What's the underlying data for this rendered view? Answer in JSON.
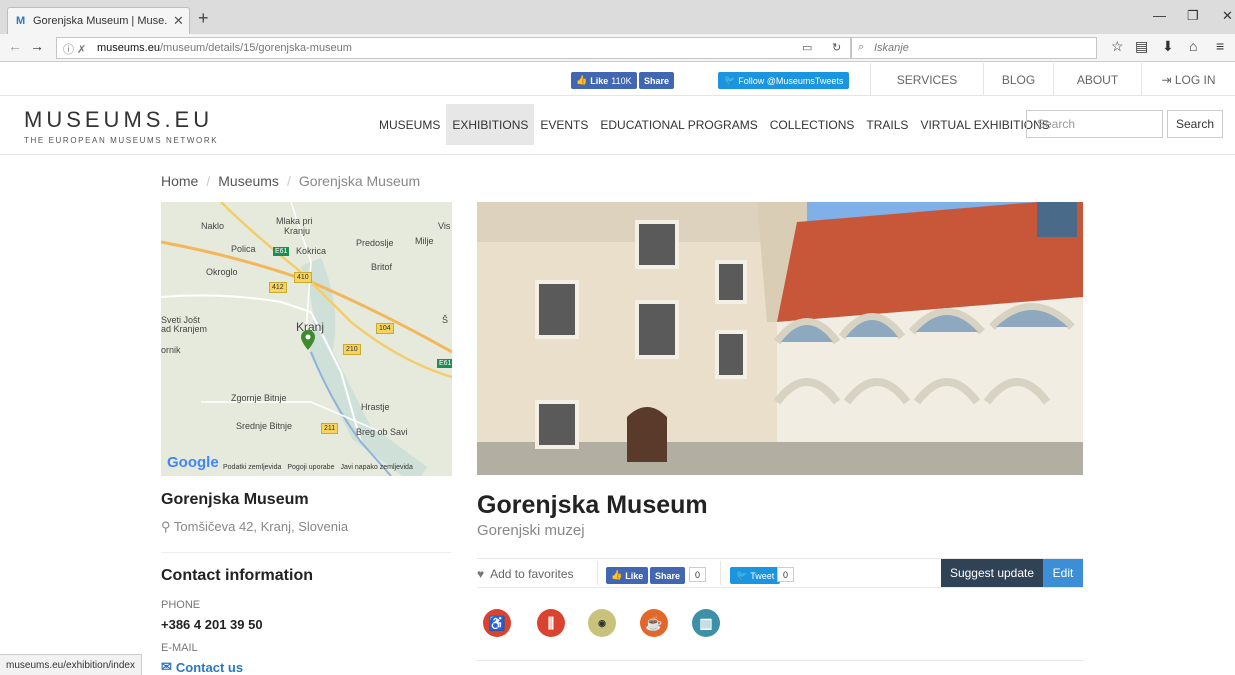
{
  "browser": {
    "tab_title": "Gorenjska Museum | Muse...",
    "url_host": "museums.eu",
    "url_path": "/museum/details/15/gorenjska-museum",
    "search_placeholder": "Iskanje",
    "status_url": "museums.eu/exhibition/index"
  },
  "topstrip": {
    "fb_like": "Like",
    "fb_count": "110K",
    "fb_share": "Share",
    "twitter_follow": "Follow @MuseumsTweets",
    "links": [
      "SERVICES",
      "BLOG",
      "ABOUT",
      "LOG IN"
    ]
  },
  "header": {
    "logo": "MUSEUMS.EU",
    "tagline": "THE EUROPEAN MUSEUMS NETWORK",
    "nav": [
      "MUSEUMS",
      "EXHIBITIONS",
      "EVENTS",
      "EDUCATIONAL PROGRAMS",
      "COLLECTIONS",
      "TRAILS",
      "VIRTUAL EXHIBITIONS"
    ],
    "active_nav": "EXHIBITIONS",
    "search_placeholder": "Search",
    "search_button": "Search"
  },
  "breadcrumb": {
    "home": "Home",
    "museums": "Museums",
    "current": "Gorenjska Museum"
  },
  "map": {
    "labels": {
      "naklo": "Naklo",
      "mlaka": "Mlaka pri",
      "kranju": "Kranju",
      "vis": "Vis",
      "polica": "Polica",
      "kokrica": "Kokrica",
      "predoslje": "Predoslje",
      "milje": "Milje",
      "okroglo": "Okroglo",
      "britof": "Britof",
      "sveti": "Sveti Jošt",
      "kranjem": "ad Kranjem",
      "kranj": "Kranj",
      "ornik": "ornik",
      "zgornje": "Zgornje Bitnje",
      "hrastje": "Hrastje",
      "srednje": "Srednje Bitnje",
      "breg": "Breg ob Savi",
      "s": "Š"
    },
    "roads": {
      "e61a": "E61",
      "r410": "410",
      "r412": "412",
      "r104": "104",
      "r210": "210",
      "e61b": "E61",
      "r211": "211"
    },
    "google": "Google",
    "footer": [
      "Podatki zemljevida",
      "Pogoji uporabe",
      "Javi napako zemljevida"
    ]
  },
  "museum": {
    "name": "Gorenjska Museum",
    "native_name": "Gorenjski muzej",
    "address": "Tomšičeva 42, Kranj, Slovenia",
    "contact_heading": "Contact information",
    "phone_label": "PHONE",
    "phone": "+386 4 201 39 50",
    "email_label": "E-MAIL",
    "email_link": "Contact us"
  },
  "actions": {
    "favorites": "Add to favorites",
    "fb_like": "Like",
    "fb_share": "Share",
    "fb_count": "0",
    "tweet": "Tweet",
    "tweet_count": "0",
    "suggest": "Suggest update",
    "edit": "Edit"
  },
  "facilities": [
    {
      "name": "wheelchair-icon",
      "color": "#d9432f"
    },
    {
      "name": "restaurant-icon",
      "color": "#d9432f"
    },
    {
      "name": "wifi-icon",
      "color": "#c9c27a"
    },
    {
      "name": "cafe-icon",
      "color": "#e4672a"
    },
    {
      "name": "shop-icon",
      "color": "#3e8fa8"
    }
  ]
}
